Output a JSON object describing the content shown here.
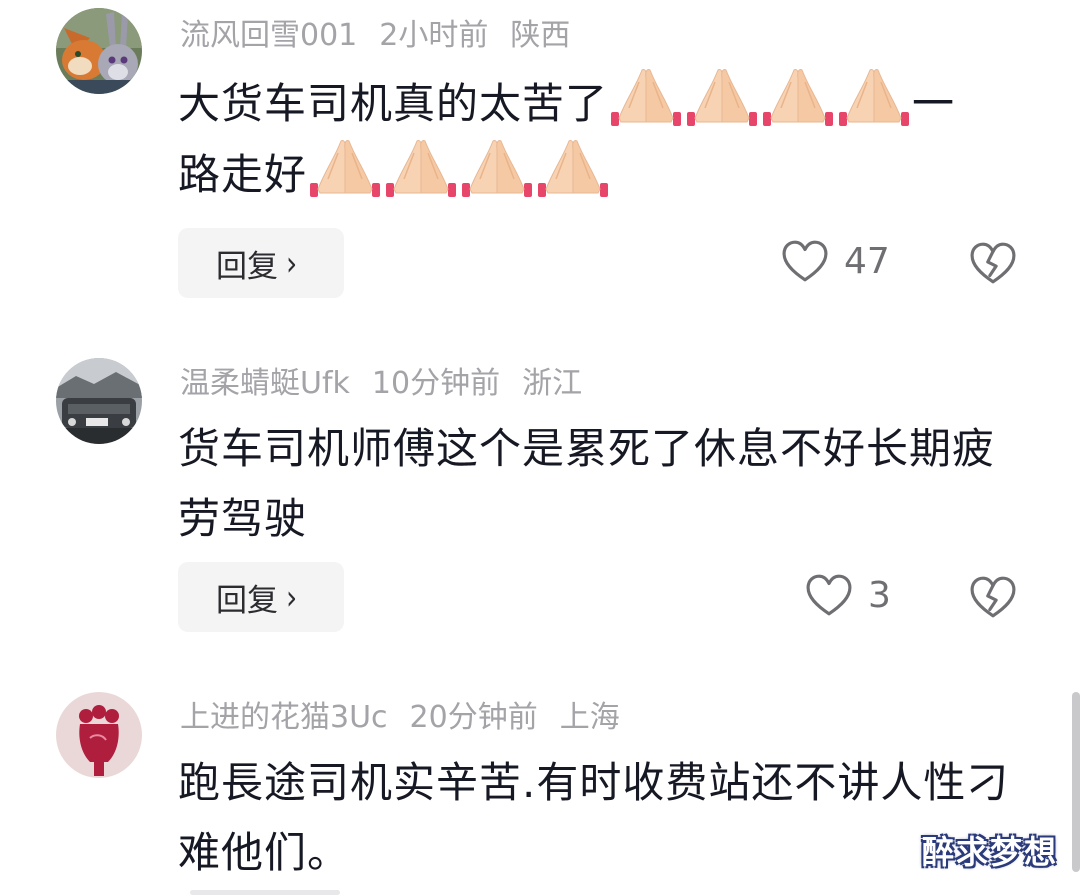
{
  "comments": [
    {
      "username": "流风回雪001",
      "time": "2小时前",
      "location": "陕西",
      "text_line1": "大货车司机真的太苦了",
      "text_line1_tail": "一",
      "text_line2": "路走好",
      "emoji": "folded-hands",
      "reply_label": "回复",
      "likes": "47"
    },
    {
      "username": "温柔蜻蜓Ufk",
      "time": "10分钟前",
      "location": "浙江",
      "text": "货车司机师傅这个是累死了休息不好长期疲劳驾驶",
      "reply_label": "回复",
      "likes": "3"
    },
    {
      "username": "上进的花猫3Uc",
      "time": "20分钟前",
      "location": "上海",
      "text": "跑長途司机实辛苦.有时收费站还不讲人性刁难他们。"
    }
  ],
  "watermark": "醉求梦想",
  "colors": {
    "meta": "#a3a3a8",
    "text": "#161823",
    "reply_bg": "#f4f4f5",
    "icon": "#6f6f73"
  }
}
